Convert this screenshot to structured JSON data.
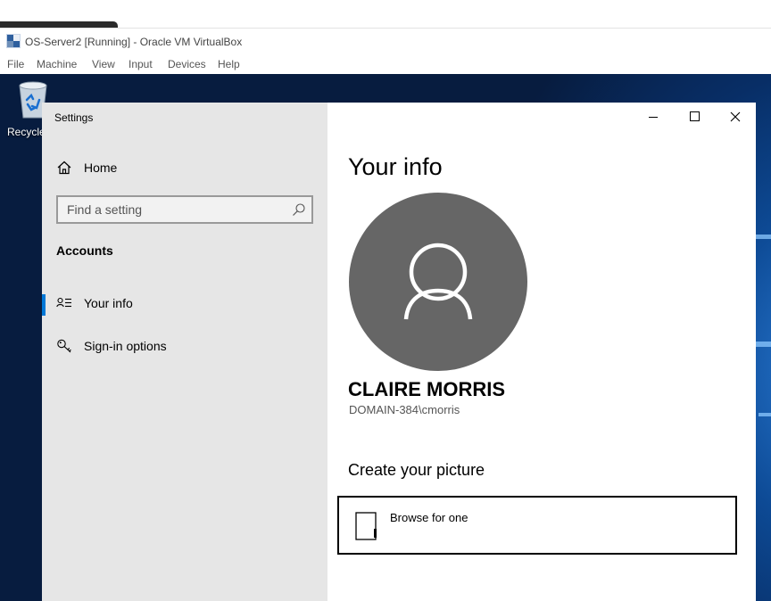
{
  "vbox": {
    "title": "OS-Server2 [Running] - Oracle VM VirtualBox",
    "menu": [
      "File",
      "Machine",
      "View",
      "Input",
      "Devices",
      "Help"
    ]
  },
  "desktop": {
    "recycle_label": "Recycle"
  },
  "settings": {
    "window_title": "Settings",
    "home_label": "Home",
    "search_placeholder": "Find a setting",
    "section": "Accounts",
    "nav": [
      {
        "label": "Your info",
        "icon": "contact-info-icon",
        "selected": true
      },
      {
        "label": "Sign-in options",
        "icon": "key-icon",
        "selected": false
      }
    ],
    "page_title": "Your info",
    "user_name": "CLAIRE MORRIS",
    "account": "DOMAIN-384\\cmorris",
    "create_picture_title": "Create your picture",
    "browse_label": "Browse for one"
  },
  "colors": {
    "sidebar_bg": "#e6e6e6",
    "accent": "#0078d7",
    "avatar_bg": "#666666"
  }
}
